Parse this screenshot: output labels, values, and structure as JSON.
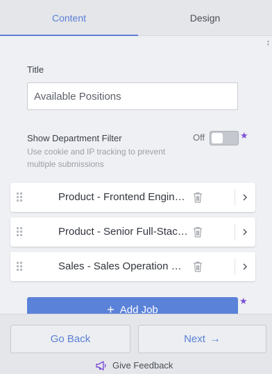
{
  "tabs": {
    "content": "Content",
    "design": "Design"
  },
  "form": {
    "title_label": "Title",
    "title_value": "Available Positions",
    "filter_label": "Show Department Filter",
    "filter_help": "Use cookie and IP tracking to prevent multiple submissions",
    "filter_state": "Off",
    "premium_star": "★"
  },
  "jobs": [
    {
      "name": "Product - Frontend Engin…"
    },
    {
      "name": "Product - Senior Full-Stac…"
    },
    {
      "name": "Sales - Sales Operation M…"
    }
  ],
  "add_job": {
    "plus": "+",
    "label": "Add Job"
  },
  "footer": {
    "back": "Go Back",
    "next": "Next",
    "next_arrow": "→",
    "feedback": "Give Feedback"
  },
  "icons": {
    "drag": "drag-handle-icon",
    "trash": "trash-icon",
    "chevron": "chevron-right-icon",
    "megaphone": "megaphone-icon"
  },
  "colors": {
    "accent": "#5b82d9",
    "premium": "#7b4fd6"
  }
}
